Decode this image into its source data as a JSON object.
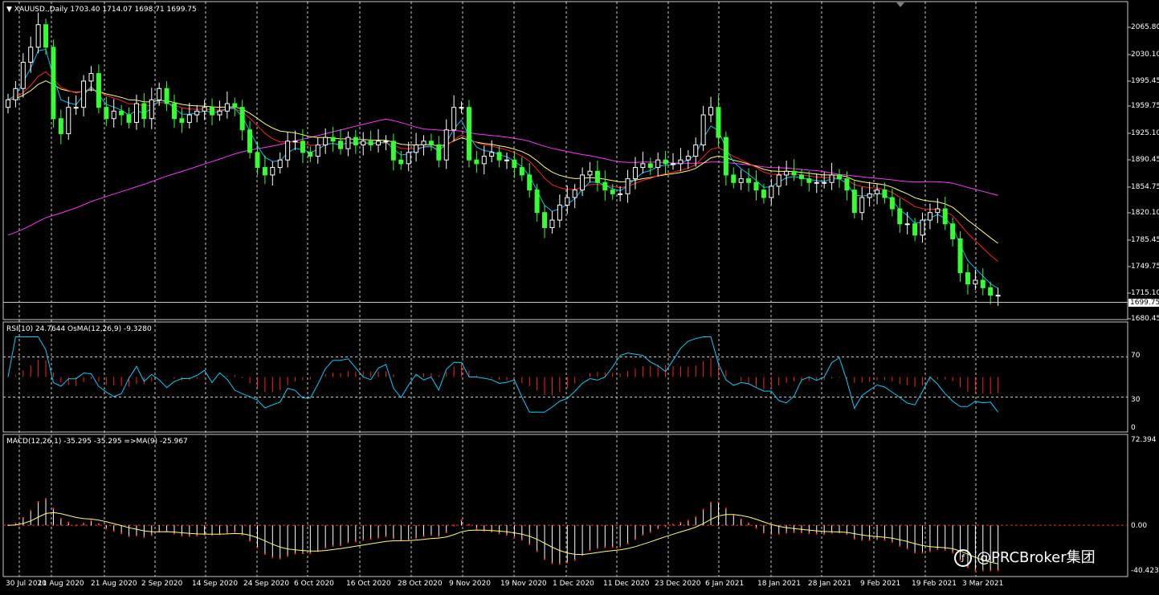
{
  "main_header": {
    "symbol": "XAUUSD.,Daily",
    "ohlc": "1703.40 1714.07 1698.71 1699.75"
  },
  "rsi_header": "RSI(10) 24.7644  OsMA(12,26,9) -9.3280",
  "macd_header": "MACD(12,26,1) -35.295 -35.295  =>MA(9) -25.967",
  "price_axis": [
    "2065.80",
    "2030.10",
    "1995.45",
    "1959.75",
    "1925.10",
    "1890.45",
    "1854.75",
    "1820.10",
    "1785.45",
    "1749.75",
    "1715.10",
    "1680.45"
  ],
  "current_price": "1699.75",
  "rsi_axis": [
    "70",
    "30",
    "0"
  ],
  "macd_axis": [
    "72.394",
    "0.00",
    "-40.423"
  ],
  "date_axis": [
    "30 Jul 2020",
    "11 Aug 2020",
    "21 Aug 2020",
    "2 Sep 2020",
    "14 Sep 2020",
    "24 Sep 2020",
    "6 Oct 2020",
    "16 Oct 2020",
    "28 Oct 2020",
    "9 Nov 2020",
    "19 Nov 2020",
    "1 Dec 2020",
    "11 Dec 2020",
    "23 Dec 2020",
    "6 Jan 2021",
    "18 Jan 2021",
    "28 Jan 2021",
    "9 Feb 2021",
    "19 Feb 2021",
    "3 Mar 2021"
  ],
  "watermark": "@PRCBroker集团",
  "colors": {
    "bull": "#ffffff",
    "bear": "#33ff33",
    "ma_fast": "#00bfff",
    "ma_mid": "#ff2020",
    "ma_slow": "#ffff66",
    "ma_long": "#ff33ff",
    "osma": "#ff2020",
    "rsi": "#00cfff",
    "macd_hist": "#ffffff",
    "macd_signal": "#ffff66"
  },
  "chart_data": [
    {
      "type": "candlestick",
      "title": "XAUUSD.,Daily",
      "ylim": [
        1680.45,
        2080
      ],
      "note_series": "approximate daily closes",
      "closes": [
        1960,
        1975,
        2010,
        2030,
        2060,
        2030,
        1935,
        1915,
        1950,
        1950,
        1985,
        1995,
        1950,
        1935,
        1945,
        1940,
        1930,
        1955,
        1935,
        1960,
        1975,
        1955,
        1935,
        1930,
        1940,
        1945,
        1950,
        1940,
        1945,
        1955,
        1950,
        1920,
        1890,
        1870,
        1860,
        1870,
        1880,
        1905,
        1905,
        1890,
        1885,
        1900,
        1910,
        1905,
        1895,
        1910,
        1900,
        1905,
        1900,
        1905,
        1905,
        1880,
        1875,
        1890,
        1900,
        1905,
        1900,
        1880,
        1920,
        1950,
        1950,
        1880,
        1875,
        1885,
        1890,
        1880,
        1880,
        1870,
        1860,
        1840,
        1810,
        1790,
        1800,
        1820,
        1830,
        1840,
        1860,
        1865,
        1850,
        1840,
        1835,
        1835,
        1855,
        1870,
        1875,
        1870,
        1880,
        1875,
        1875,
        1880,
        1885,
        1900,
        1940,
        1950,
        1910,
        1860,
        1850,
        1855,
        1850,
        1840,
        1830,
        1845,
        1860,
        1865,
        1860,
        1855,
        1850,
        1850,
        1850,
        1860,
        1855,
        1840,
        1810,
        1830,
        1835,
        1840,
        1830,
        1815,
        1795,
        1795,
        1780,
        1800,
        1810,
        1815,
        1795,
        1775,
        1730,
        1715,
        1720,
        1710,
        1700,
        1700
      ]
    },
    {
      "type": "line",
      "title": "RSI(10) 24.7644  OsMA(12,26,9) -9.3280",
      "ylim": [
        0,
        100
      ],
      "levels": [
        70,
        30
      ]
    },
    {
      "type": "bar",
      "title": "MACD(12,26,1) -35.295 -35.295  =>MA(9) -25.967",
      "ylim": [
        -40.423,
        72.394
      ]
    }
  ]
}
